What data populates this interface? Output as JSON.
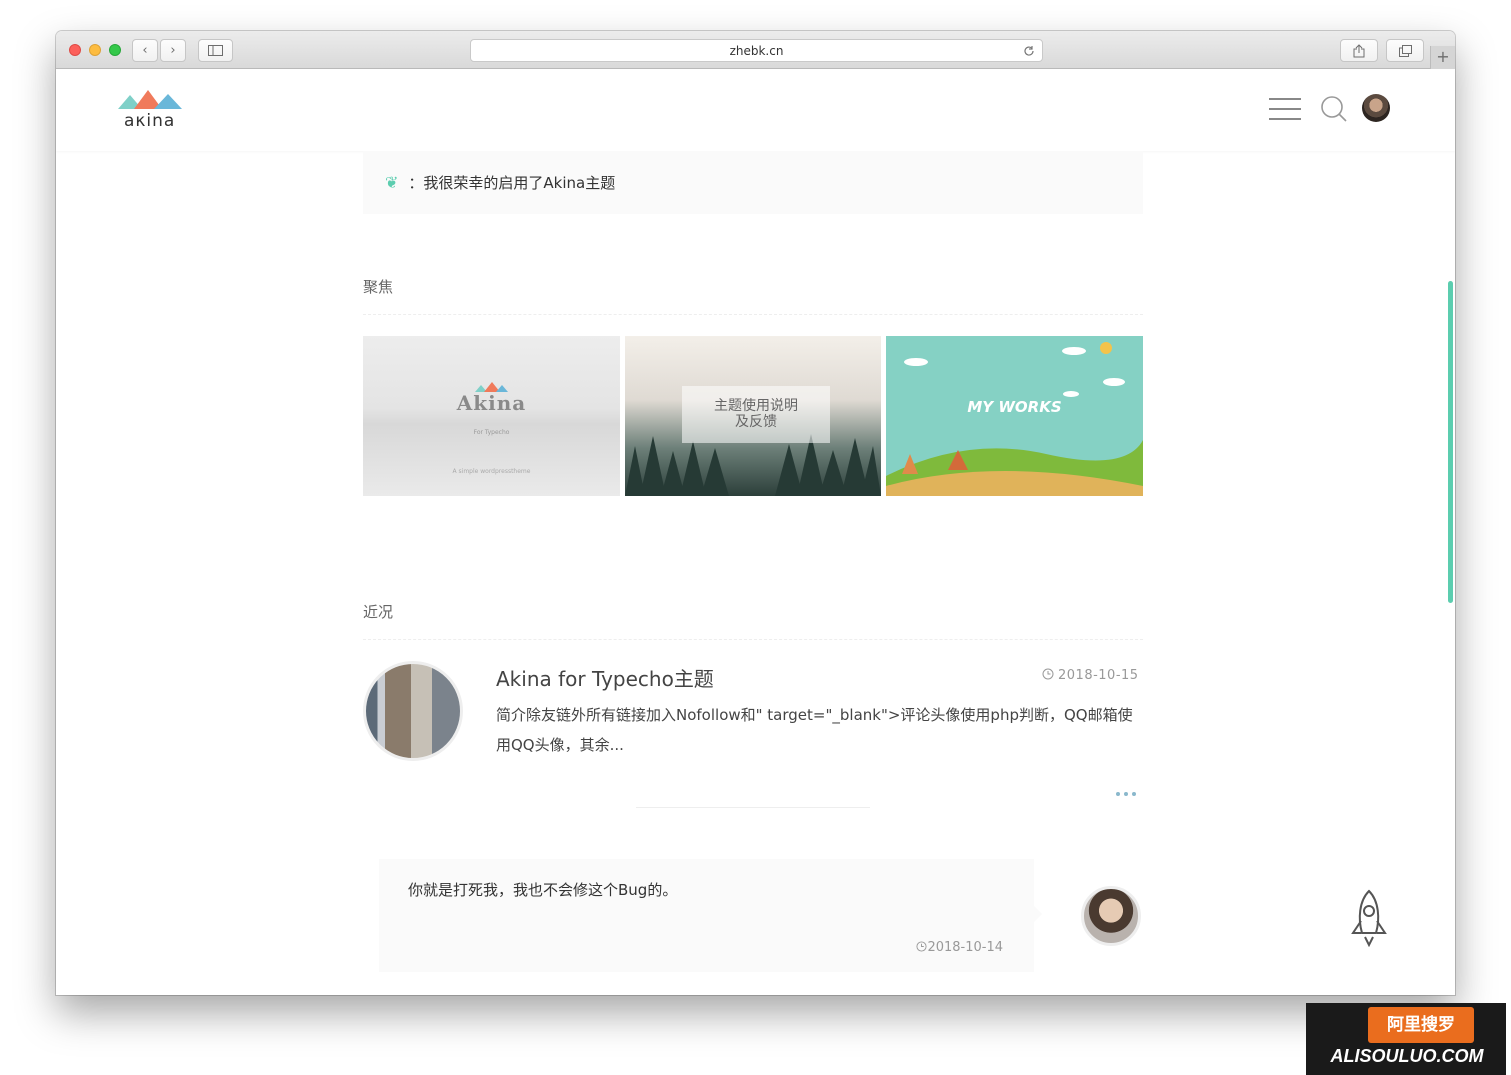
{
  "browser": {
    "url": "zhebk.cn",
    "back_glyph": "‹",
    "forward_glyph": "›",
    "plus_glyph": "+"
  },
  "site": {
    "logo_text": "aκina",
    "accent_color": "#5ccdaf"
  },
  "notice": {
    "text": "：我很荣幸的启用了Akina主题"
  },
  "focus": {
    "title": "聚焦",
    "cards": [
      {
        "title": "Akina",
        "sub": "For Typecho",
        "caption": "A simple wordpresstheme"
      },
      {
        "title": "主题使用说明\n及反馈"
      },
      {
        "title": "MY WORKS"
      }
    ]
  },
  "recent": {
    "title": "近况",
    "posts": [
      {
        "title": "Akina for Typecho主题",
        "date": "2018-10-15",
        "excerpt": "简介除友链外所有链接加入Nofollow和\" target=\"_blank\">评论头像使用php判断，QQ邮箱使用QQ头像，其余..."
      }
    ]
  },
  "comment": {
    "text": "你就是打死我，我也不会修这个Bug的。",
    "date": "2018-10-14"
  },
  "watermark": {
    "badge": "阿里搜罗",
    "url": "ALISOULUO.COM"
  },
  "icons": [
    "menu-icon",
    "search-icon",
    "avatar",
    "leaf-icon",
    "clock-icon",
    "more-dots-icon",
    "rocket-icon",
    "reload-icon",
    "share-icon",
    "tabs-icon",
    "sidebar-icon"
  ]
}
